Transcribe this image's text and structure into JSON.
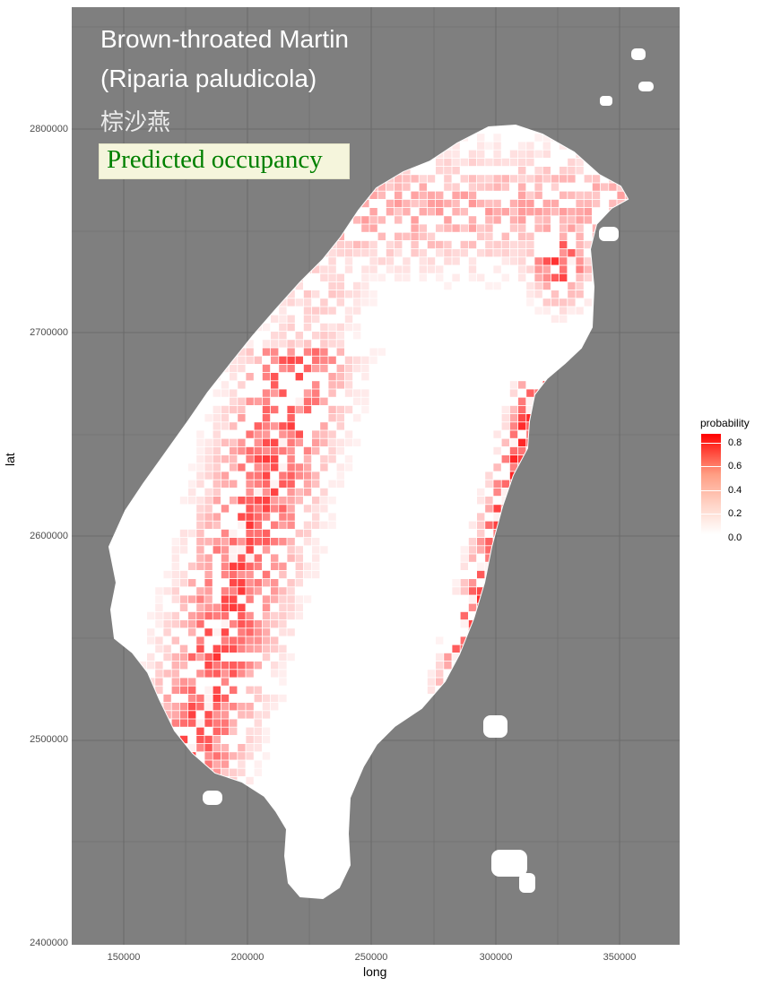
{
  "map": {
    "title_line1": "Brown-throated Martin",
    "title_line2": "(Riparia paludicola)",
    "title_chinese": "棕沙燕",
    "subtitle": "Predicted occupancy",
    "x_axis_label": "long",
    "y_axis_label": "lat",
    "x_ticks": [
      "150000",
      "200000",
      "250000",
      "300000",
      "350000"
    ],
    "y_ticks": [
      "2800000",
      "2700000",
      "2600000",
      "2500000",
      "2400000"
    ],
    "panel_background": "#7f7f7f",
    "land_color": "#ffffff",
    "high_color": "#ff0000"
  },
  "legend": {
    "title": "probability",
    "labels": [
      "0.8",
      "0.6",
      "0.4",
      "0.2",
      "0.0"
    ]
  }
}
